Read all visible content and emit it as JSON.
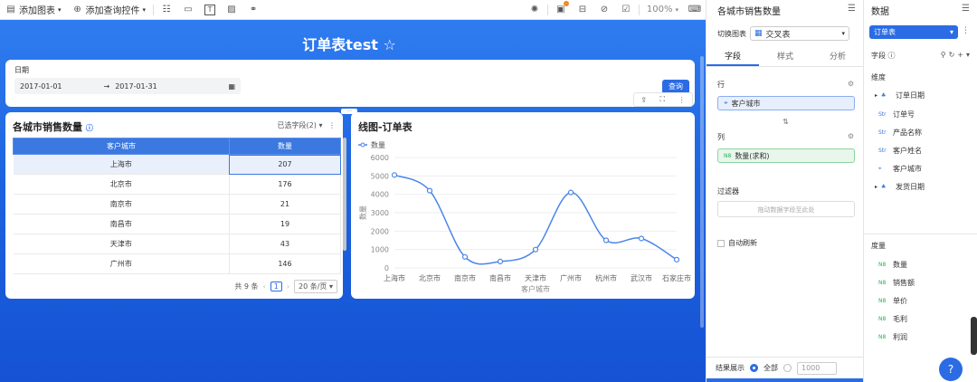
{
  "toolbar": {
    "add_chart": "添加图表",
    "add_query": "添加查询控件",
    "zoom": "100%"
  },
  "canvas": {
    "title": "订单表test ☆"
  },
  "filter": {
    "label": "日期",
    "start": "2017-01-01",
    "end": "2017-01-31",
    "query_button": "查询"
  },
  "table_card": {
    "title": "各城市销售数量",
    "selected_fields": "已选字段(2)",
    "columns": [
      "客户城市",
      "数量"
    ],
    "rows": [
      [
        "上海市",
        "207"
      ],
      [
        "北京市",
        "176"
      ],
      [
        "南京市",
        "21"
      ],
      [
        "南昌市",
        "19"
      ],
      [
        "天津市",
        "43"
      ],
      [
        "广州市",
        "146"
      ]
    ],
    "total": "共 9 条",
    "page": "1",
    "page_size": "20 条/页"
  },
  "chart_card": {
    "title": "线图-订单表"
  },
  "chart_data": {
    "type": "line",
    "categories": [
      "上海市",
      "北京市",
      "南京市",
      "南昌市",
      "天津市",
      "广州市",
      "杭州市",
      "武汉市",
      "石家庄市"
    ],
    "series": [
      {
        "name": "数量",
        "values": [
          5050,
          4200,
          600,
          350,
          1000,
          4100,
          1500,
          1600,
          450
        ]
      }
    ],
    "xlabel": "客户城市",
    "ylabel": "数量",
    "ylim": [
      0,
      6000
    ],
    "yticks": [
      "0",
      "1000",
      "2000",
      "3000",
      "4000",
      "5000",
      "6000"
    ],
    "line_color": "#4a86e8"
  },
  "right_panel": {
    "title": "各城市销售数量",
    "switch_label": "切换图表",
    "chart_type": "交叉表",
    "tabs": [
      "字段",
      "样式",
      "分析"
    ],
    "row_label": "行",
    "row_field": "客户城市",
    "col_label": "列",
    "col_field": "数量(求和)",
    "filter_label": "过滤器",
    "filter_placeholder": "拖动数据字段至此处",
    "auto_refresh": "自动刷新",
    "result_label": "结果展示",
    "all_label": "全部",
    "limit": "1000"
  },
  "data_panel": {
    "title": "数据",
    "dataset": "订单表",
    "fields_label": "字段",
    "dimension_label": "维度",
    "dimensions": [
      {
        "type": "tree",
        "name": "订单日期"
      },
      {
        "type": "Str",
        "name": "订单号"
      },
      {
        "type": "Str",
        "name": "产品名称"
      },
      {
        "type": "Str",
        "name": "客户姓名"
      },
      {
        "type": "geo",
        "name": "客户城市"
      },
      {
        "type": "tree",
        "name": "发货日期"
      }
    ],
    "measure_label": "度量",
    "measures": [
      "数量",
      "销售额",
      "单价",
      "毛利",
      "利润"
    ]
  },
  "colors": {
    "primary": "#2b6ce4",
    "canvas_bg": "#1d63e0"
  }
}
